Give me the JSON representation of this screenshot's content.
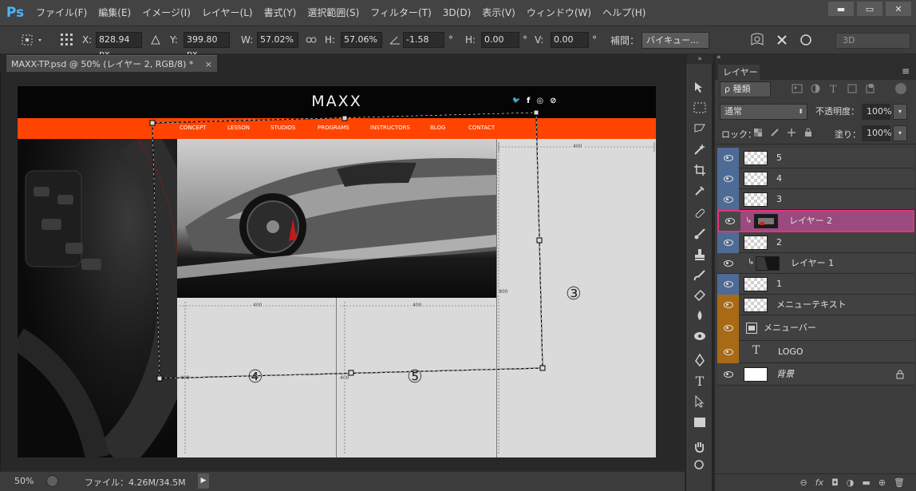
{
  "app": {
    "logo": "Ps"
  },
  "menu": [
    "ファイル(F)",
    "編集(E)",
    "イメージ(I)",
    "レイヤー(L)",
    "書式(Y)",
    "選択範囲(S)",
    "フィルター(T)",
    "3D(D)",
    "表示(V)",
    "ウィンドウ(W)",
    "ヘルプ(H)"
  ],
  "window": {
    "minimize": "▬",
    "restore": "▭",
    "close": "✕"
  },
  "options": {
    "x_label": "X:",
    "x_value": "828.94 px",
    "y_label": "Y:",
    "y_value": "399.80 px",
    "w_label": "W:",
    "w_value": "57.02%",
    "h_label": "H:",
    "h_value": "57.06%",
    "angle_value": "-1.58",
    "deg": "°",
    "hskew_label": "H:",
    "hskew_value": "0.00",
    "vskew_label": "V:",
    "vskew_value": "0.00",
    "interp_label": "補間：",
    "interp_value": "バイキュー...",
    "search_3d": "3D"
  },
  "tab": {
    "title": "MAXX-TP.psd @ 50% (レイヤー 2, RGB/8) *",
    "close": "×"
  },
  "website": {
    "logo": "MAXX",
    "nav": [
      "CONCEPT",
      "LESSON",
      "STUDIOS",
      "PROGRAMS",
      "INSTRUCTORS",
      "BLOG",
      "CONTACT"
    ],
    "social_icons": [
      "twitter-icon",
      "facebook-icon",
      "instagram-icon",
      "rss-icon"
    ],
    "social_glyphs": [
      "🐦",
      "f",
      "◎",
      "⊘"
    ],
    "dim_400": "400",
    "dim_800": "800",
    "dim_ticks": [
      "400",
      "400",
      "400",
      "400",
      "400"
    ],
    "region_3": "③",
    "region_4": "④",
    "region_5": "⑤"
  },
  "status": {
    "zoom": "50%",
    "file": "ファイル：4.26M/34.5M",
    "arrow": "▶"
  },
  "layers_panel": {
    "tab": "レイヤー",
    "menu_glyph": "≡",
    "collapse_glyph": "«",
    "kind_label": "ρ 種類",
    "blend_mode": "通常",
    "opacity_label": "不透明度：",
    "opacity_value": "100%",
    "lock_label": "ロック：",
    "fill_label": "塗り：",
    "fill_value": "100%",
    "layers": [
      {
        "name": "5",
        "tag": "blue",
        "visible": true
      },
      {
        "name": "4",
        "tag": "blue",
        "visible": true
      },
      {
        "name": "3",
        "tag": "blue",
        "visible": true
      },
      {
        "name": "レイヤー 2",
        "tag": "pink",
        "visible": true,
        "clip": true,
        "selected": true
      },
      {
        "name": "2",
        "tag": "blue",
        "visible": true
      },
      {
        "name": "レイヤー 1",
        "tag": "none",
        "visible": true,
        "clip": true
      },
      {
        "name": "1",
        "tag": "blue",
        "visible": true
      },
      {
        "name": "メニューテキスト",
        "tag": "orange",
        "visible": true
      },
      {
        "name": "メニューバー",
        "tag": "orange",
        "visible": true
      },
      {
        "name": "LOGO",
        "tag": "orange",
        "visible": true,
        "type": "text"
      },
      {
        "name": "背景",
        "tag": "none",
        "visible": true,
        "locked": true
      }
    ],
    "bottom_icons": [
      "link-icon",
      "fx-icon",
      "mask-icon",
      "adjustment-icon",
      "group-icon",
      "new-layer-icon",
      "trash-icon"
    ],
    "bottom_glyphs": [
      "⊖",
      "fx",
      "◘",
      "◑",
      "▬",
      "⊕",
      "🗑"
    ]
  },
  "colors": {
    "nav_orange": "#ff4400",
    "tag_blue": "#4e6b95",
    "tag_orange": "#a86a14",
    "tag_pink": "#9a4a7e",
    "selection_border": "#e8317c"
  }
}
